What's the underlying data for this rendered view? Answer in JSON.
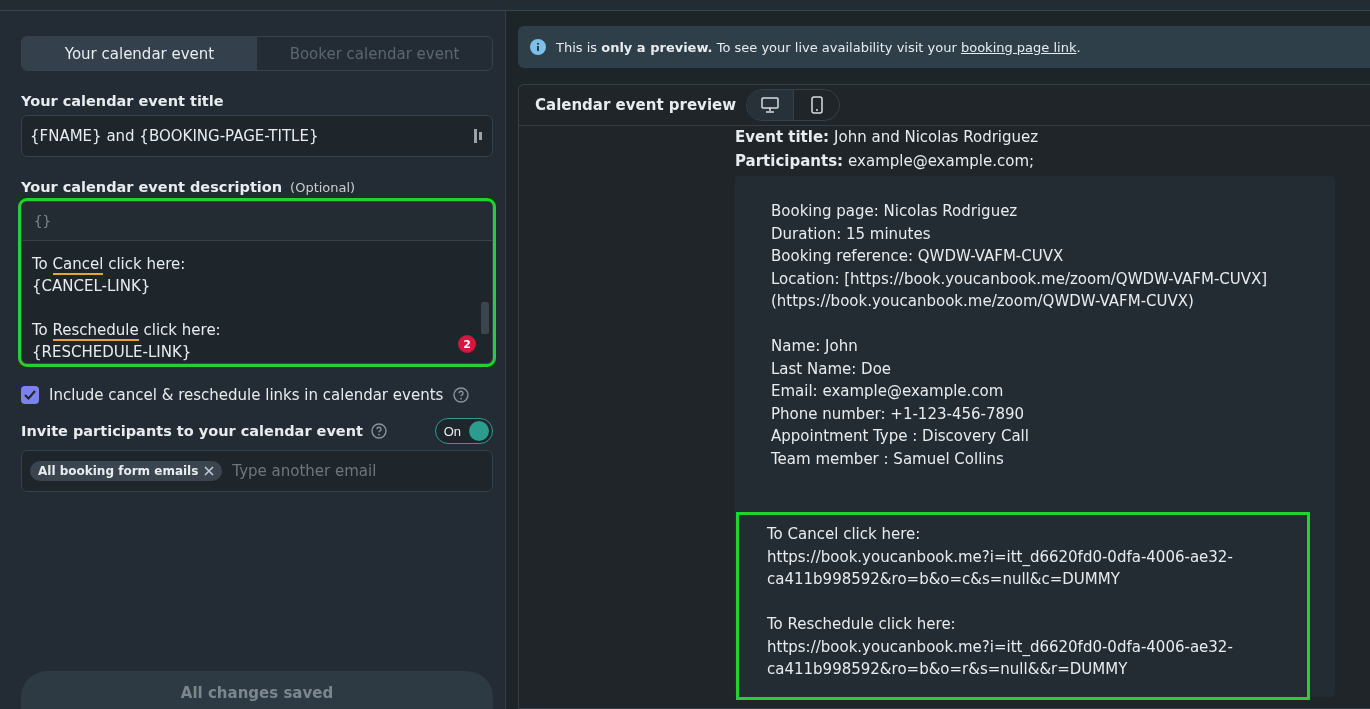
{
  "tabs": [
    {
      "label": "Your calendar event",
      "selected": true
    },
    {
      "label": "Booker calendar event",
      "selected": false
    }
  ],
  "title_field": {
    "label": "Your calendar event title",
    "value": "{FNAME} and {BOOKING-PAGE-TITLE}"
  },
  "description": {
    "label": "Your calendar event description",
    "hint": "(Optional)",
    "toolbar_glyph": "{}",
    "badge": "2",
    "highlighted": true,
    "paragraphs": [
      [
        [
          {
            "text": "To "
          },
          {
            "text": "Cancel",
            "flagged": true
          },
          {
            "text": " click here:"
          }
        ],
        [
          {
            "text": "{CANCEL-LINK}"
          }
        ]
      ],
      [
        [
          {
            "text": "To "
          },
          {
            "text": "Reschedule",
            "flagged": true
          },
          {
            "text": " click here:"
          }
        ],
        [
          {
            "text": "{RESCHEDULE-LINK}"
          }
        ]
      ]
    ]
  },
  "include_links": {
    "label": "Include cancel & reschedule links in calendar events",
    "checked": true
  },
  "invite": {
    "label": "Invite participants to your calendar event",
    "toggle_label": "On",
    "on": true,
    "chips": [
      "All booking form emails"
    ],
    "placeholder": "Type another email"
  },
  "save_button": "All changes saved",
  "notice": "This is **only a preview.** To see your live availability visit your ",
  "notice_link": "booking page link",
  "notice_end": ".",
  "preview": {
    "title": "Calendar event preview",
    "devices": [
      {
        "kind": "desktop",
        "selected": true
      },
      {
        "kind": "mobile",
        "selected": false
      }
    ],
    "fields": [
      {
        "label": "Event title:",
        "value": "John and Nicolas Rodriguez"
      },
      {
        "label": "Participants:",
        "value": "example@example.com;"
      }
    ],
    "body_blocks": [
      {
        "highlighted": false,
        "paragraphs": [
          [
            "Booking page: Nicolas Rodriguez",
            "Duration: 15 minutes",
            "Booking reference: QWDW-VAFM-CUVX",
            "Location: [https://book.youcanbook.me/zoom/QWDW-VAFM-CUVX]",
            "(https://book.youcanbook.me/zoom/QWDW-VAFM-CUVX)"
          ],
          [
            "Name: John",
            "Last Name: Doe",
            "Email: example@example.com",
            "Phone number: +1-123-456-7890",
            "Appointment Type : Discovery Call",
            "Team member : Samuel Collins"
          ]
        ]
      },
      {
        "highlighted": true,
        "paragraphs": [
          [
            "To Cancel click here:",
            "https://book.youcanbook.me?i=itt_d6620fd0-0dfa-4006-ae32-ca411b998592&ro=b&o=c&s=null&c=DUMMY"
          ],
          [
            "To Reschedule click here:",
            "https://book.youcanbook.me?i=itt_d6620fd0-0dfa-4006-ae32-ca411b998592&ro=b&o=r&s=null&&r=DUMMY"
          ]
        ]
      }
    ]
  }
}
